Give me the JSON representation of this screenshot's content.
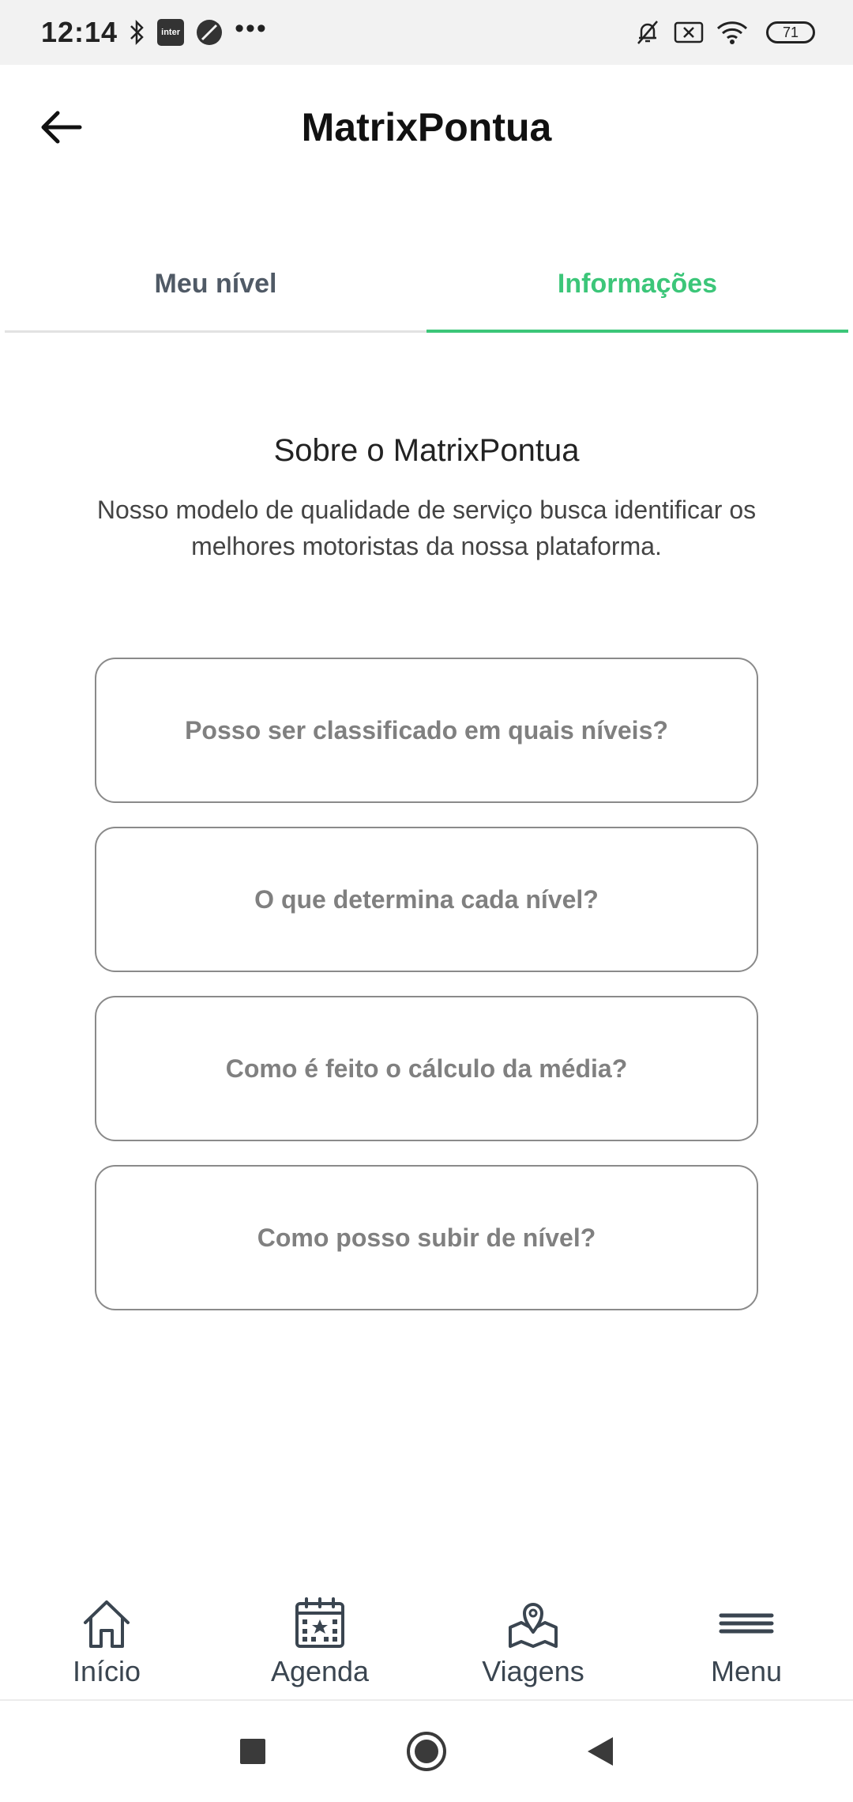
{
  "status_bar": {
    "time": "12:14",
    "inter_label": "inter",
    "more": "•••",
    "battery": "71"
  },
  "app_bar": {
    "title": "MatrixPontua"
  },
  "tabs": [
    {
      "label": "Meu nível",
      "active": false
    },
    {
      "label": "Informações",
      "active": true
    }
  ],
  "about": {
    "title": "Sobre o MatrixPontua",
    "description": "Nosso modelo de qualidade de serviço busca identificar os melhores motoristas da nossa plataforma."
  },
  "faq": [
    {
      "question": "Posso ser classificado em quais níveis?"
    },
    {
      "question": "O que determina cada nível?"
    },
    {
      "question": "Como é feito o cálculo da média?"
    },
    {
      "question": "Como posso subir de nível?"
    }
  ],
  "bottom_nav": [
    {
      "label": "Início",
      "icon": "home-icon"
    },
    {
      "label": "Agenda",
      "icon": "calendar-icon"
    },
    {
      "label": "Viagens",
      "icon": "map-pin-icon"
    },
    {
      "label": "Menu",
      "icon": "hamburger-icon"
    }
  ],
  "colors": {
    "accent": "#3cc679",
    "tab_inactive": "#505a66",
    "card_border": "#8a8a8a"
  }
}
